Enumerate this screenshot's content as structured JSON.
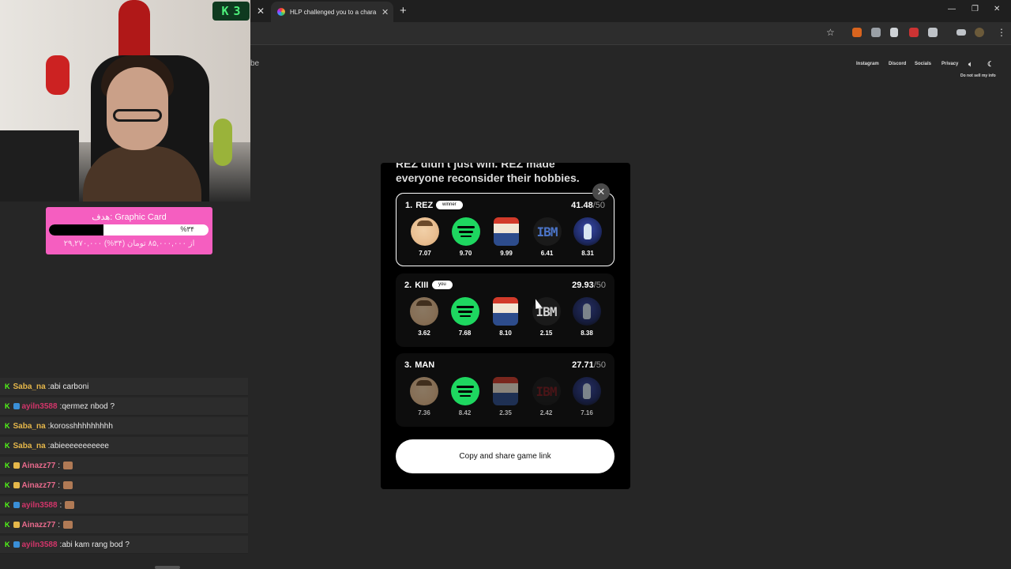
{
  "counter": {
    "logo": "K",
    "value": "3"
  },
  "goal": {
    "title": "هدف: Graphic Card",
    "progress_percent": 34,
    "progress_label": "%۳۴",
    "subtitle": "۲۹,۲۷۰,۰۰۰ از ۸۵,۰۰۰,۰۰۰ تومان (۳۴%)"
  },
  "chat": [
    {
      "user": "Saba_na",
      "user_color": "#e6b74a",
      "message": "abi carboni",
      "emote": false
    },
    {
      "user": "ayiln3588",
      "user_color": "#d3356a",
      "message": "qermez nbod ?",
      "emote": false
    },
    {
      "user": "Saba_na",
      "user_color": "#e6b74a",
      "message": "korosshhhhhhhhh",
      "emote": false
    },
    {
      "user": "Saba_na",
      "user_color": "#e6b74a",
      "message": "abieeeeeeeeeee",
      "emote": false
    },
    {
      "user": "Ainazz77",
      "user_color": "#e86a8c",
      "message": "",
      "emote": true
    },
    {
      "user": "Ainazz77",
      "user_color": "#e86a8c",
      "message": "",
      "emote": true
    },
    {
      "user": "ayiln3588",
      "user_color": "#d3356a",
      "message": "",
      "emote": true
    },
    {
      "user": "Ainazz77",
      "user_color": "#e86a8c",
      "message": "",
      "emote": true
    },
    {
      "user": "ayiln3588",
      "user_color": "#d3356a",
      "message": "abi kam rang bod ?",
      "emote": false
    }
  ],
  "browser": {
    "tab_title": "HLP challenged you to a chara",
    "cut_text": "be",
    "nav": [
      "Instagram",
      "Discord",
      "Socials",
      "Privacy"
    ],
    "do_not_sell": "Do not sell my info"
  },
  "modal": {
    "headline": "REZ didn't just win. REZ made everyone reconsider their hobbies.",
    "share_label": "Copy and share game link",
    "icons": [
      "peter-griffin",
      "spotify",
      "roblox",
      "ibm",
      "pen"
    ],
    "players": [
      {
        "rank": "1.",
        "name": "REZ",
        "tag": "winner",
        "score": "41.48",
        "max": "/50",
        "values": [
          "7.07",
          "9.70",
          "9.99",
          "6.41",
          "8.31"
        ]
      },
      {
        "rank": "2.",
        "name": "KIII",
        "tag": "you",
        "score": "29.93",
        "max": "/50",
        "values": [
          "3.62",
          "7.68",
          "8.10",
          "2.15",
          "8.38"
        ]
      },
      {
        "rank": "3.",
        "name": "MAN",
        "tag": "",
        "score": "27.71",
        "max": "/50",
        "values": [
          "7.36",
          "8.42",
          "2.35",
          "2.42",
          "7.16"
        ]
      }
    ]
  },
  "colors": {
    "accent_pink": "#f55ec0",
    "kick_green": "#53fc18",
    "spotify_green": "#1ed760"
  }
}
